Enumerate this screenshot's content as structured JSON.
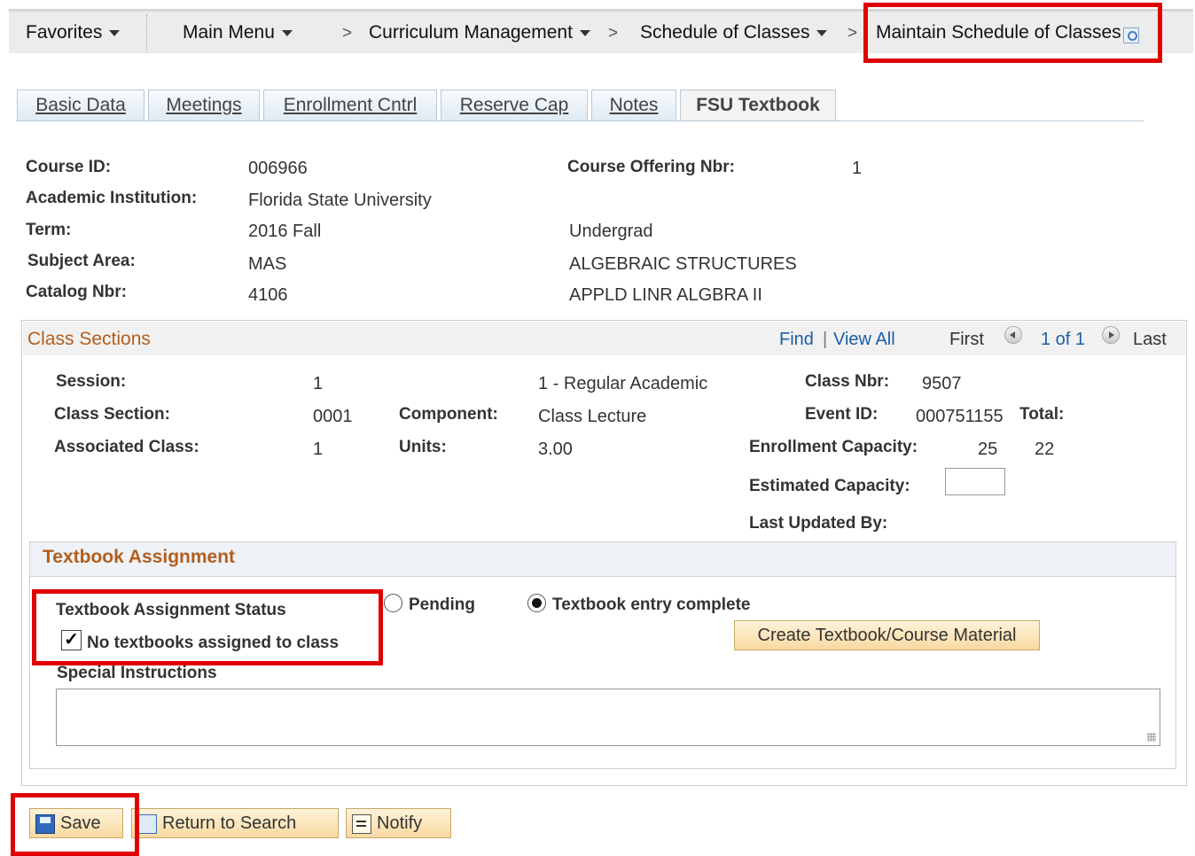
{
  "breadcrumb": {
    "favorites": "Favorites",
    "main_menu": "Main Menu",
    "curriculum": "Curriculum Management",
    "schedule": "Schedule of Classes",
    "maintain": "Maintain Schedule of Classes",
    "separator": ">"
  },
  "tabs": [
    {
      "label": "Basic Data"
    },
    {
      "label": "Meetings"
    },
    {
      "label": "Enrollment Cntrl"
    },
    {
      "label": "Reserve Cap"
    },
    {
      "label": "Notes"
    },
    {
      "label": "FSU Textbook"
    }
  ],
  "course": {
    "course_id_label": "Course ID:",
    "course_id": "006966",
    "offering_label": "Course Offering Nbr:",
    "offering": "1",
    "institution_label": "Academic Institution:",
    "institution": "Florida State University",
    "term_label": "Term:",
    "term": "2016 Fall",
    "career": "Undergrad",
    "subject_label": "Subject Area:",
    "subject": "MAS",
    "subject_desc": "ALGEBRAIC STRUCTURES",
    "catalog_label": "Catalog Nbr:",
    "catalog": "4106",
    "catalog_desc": "APPLD LINR ALGBRA II"
  },
  "class_sections": {
    "title": "Class Sections",
    "find": "Find",
    "divider": "|",
    "view_all": "View All",
    "first": "First",
    "count": "1 of 1",
    "last": "Last",
    "session_label": "Session:",
    "session": "1",
    "session_desc": "1 - Regular Academic",
    "class_nbr_label": "Class Nbr:",
    "class_nbr": "9507",
    "section_label": "Class Section:",
    "section": "0001",
    "component_label": "Component:",
    "component": "Class Lecture",
    "event_label": "Event ID:",
    "event": "000751155",
    "total_label": "Total:",
    "assoc_label": "Associated Class:",
    "assoc": "1",
    "units_label": "Units:",
    "units": "3.00",
    "enroll_cap_label": "Enrollment Capacity:",
    "enroll_cap": "25",
    "total": "22",
    "est_cap_label": "Estimated Capacity:",
    "est_cap": "",
    "last_updated_label": "Last Updated By:"
  },
  "textbook": {
    "title": "Textbook Assignment",
    "status_label": "Textbook Assignment Status",
    "pending": "Pending",
    "complete": "Textbook entry complete",
    "selected": "complete",
    "no_textbooks": "No textbooks assigned to class",
    "no_textbooks_checked": true,
    "check_mark": "✓",
    "create_button": "Create Textbook/Course Material",
    "special_label": "Special Instructions",
    "special_value": ""
  },
  "buttons": {
    "save": "Save",
    "return": "Return to Search",
    "notify": "Notify"
  },
  "colors": {
    "highlight": "#e00000",
    "section_title": "#b25e1e",
    "link": "#1a5fa3"
  }
}
